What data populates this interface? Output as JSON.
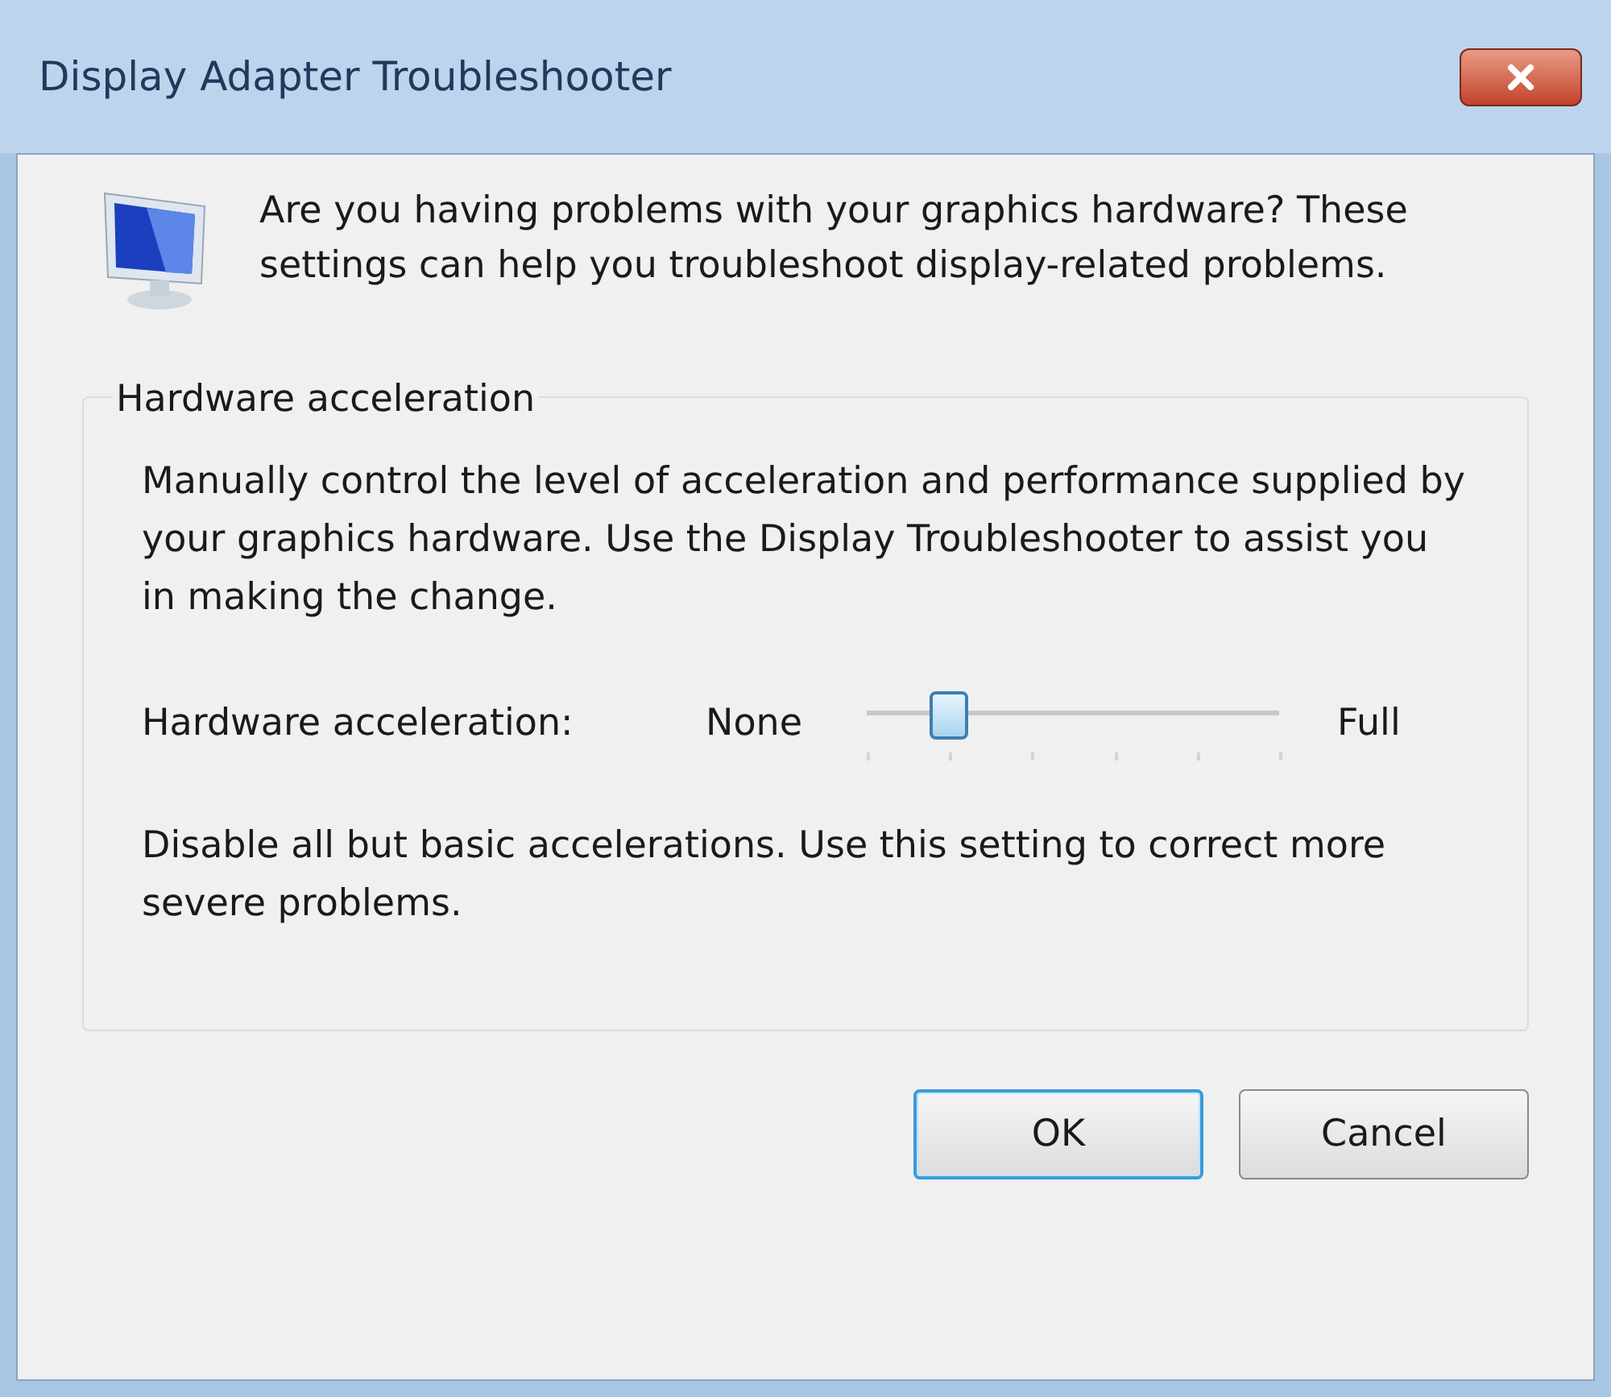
{
  "window": {
    "title": "Display Adapter Troubleshooter"
  },
  "intro": "Are you having problems with your graphics hardware? These settings can help you troubleshoot display-related problems.",
  "group": {
    "title": "Hardware acceleration",
    "description": "Manually control the level of acceleration and performance supplied by your graphics hardware. Use the Display Troubleshooter to assist you in making the change.",
    "slider": {
      "label": "Hardware acceleration:",
      "min_label": "None",
      "max_label": "Full",
      "level": 0.2
    },
    "hint": "Disable all but basic accelerations. Use this setting to correct more severe problems."
  },
  "buttons": [
    {
      "label": "OK",
      "selected": true
    },
    {
      "label": "Cancel",
      "selected": false
    }
  ]
}
